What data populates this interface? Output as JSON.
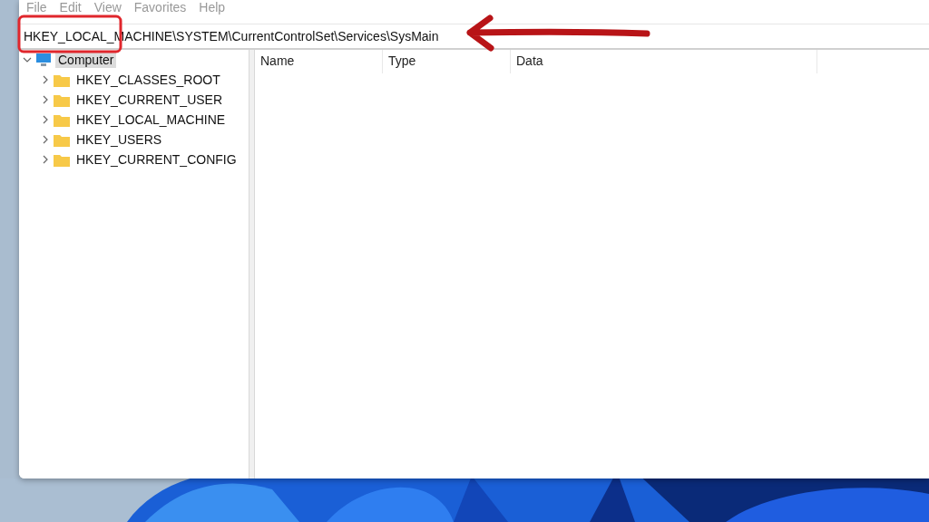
{
  "menu": [
    "File",
    "Edit",
    "View",
    "Favorites",
    "Help"
  ],
  "address": {
    "value": "HKEY_LOCAL_MACHINE\\SYSTEM\\CurrentControlSet\\Services\\SysMain"
  },
  "tree": [
    {
      "label": "Computer",
      "kind": "computer",
      "expanded": true,
      "selected": true,
      "children": [
        {
          "label": "HKEY_CLASSES_ROOT",
          "kind": "folder",
          "expanded": false,
          "selected": false
        },
        {
          "label": "HKEY_CURRENT_USER",
          "kind": "folder",
          "expanded": false,
          "selected": false
        },
        {
          "label": "HKEY_LOCAL_MACHINE",
          "kind": "folder",
          "expanded": false,
          "selected": false
        },
        {
          "label": "HKEY_USERS",
          "kind": "folder",
          "expanded": false,
          "selected": false
        },
        {
          "label": "HKEY_CURRENT_CONFIG",
          "kind": "folder",
          "expanded": false,
          "selected": false
        }
      ]
    }
  ],
  "columns": [
    "Name",
    "Type",
    "Data"
  ],
  "annotations": [
    {
      "kind": "box"
    },
    {
      "kind": "arrow"
    }
  ]
}
